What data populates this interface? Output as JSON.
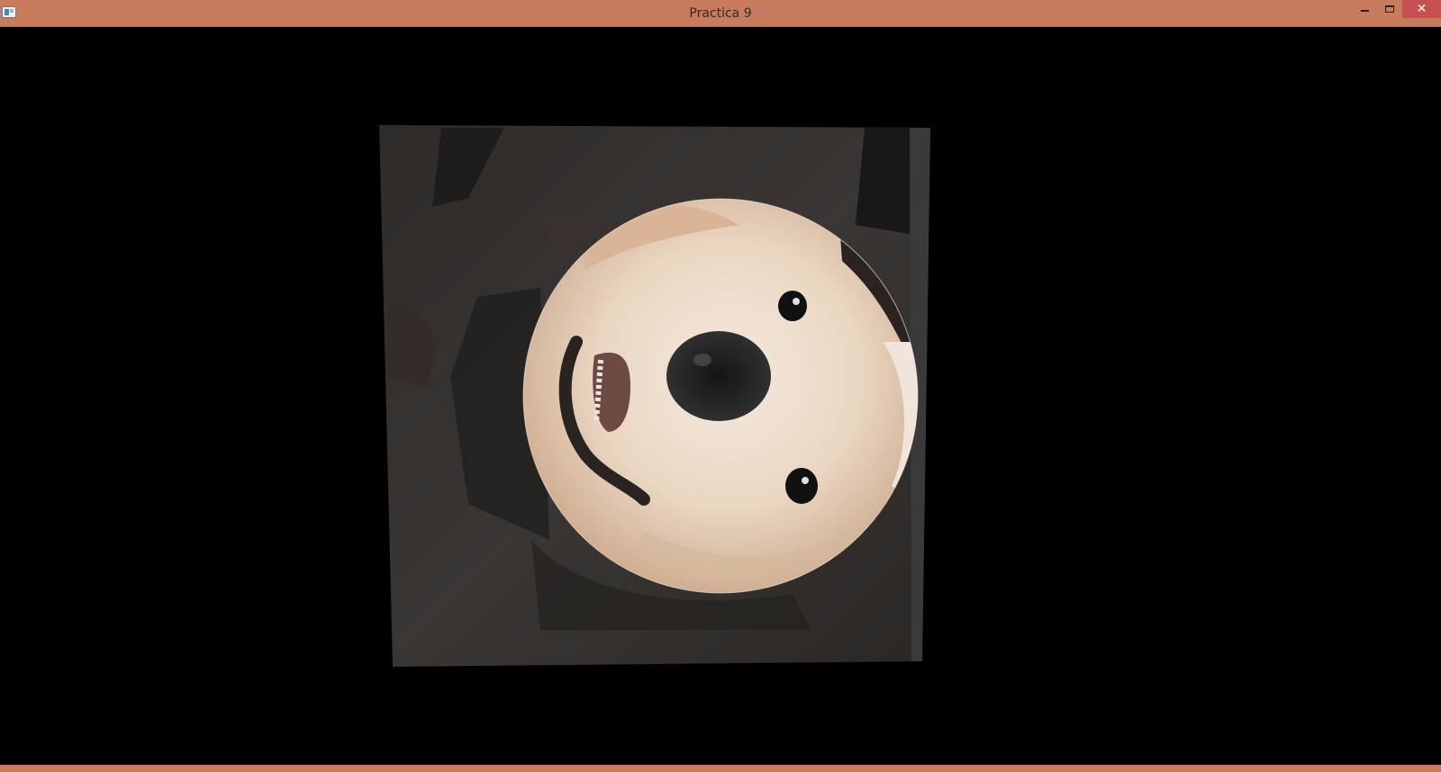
{
  "window": {
    "title": "Practica 9",
    "controls": {
      "minimize": "minimize",
      "maximize": "maximize",
      "close": "✕"
    }
  },
  "colors": {
    "titlebar": "#c97c5d",
    "close_button": "#c75050",
    "canvas_background": "#000000"
  },
  "scene": {
    "description_icon": "dog-face-image"
  }
}
